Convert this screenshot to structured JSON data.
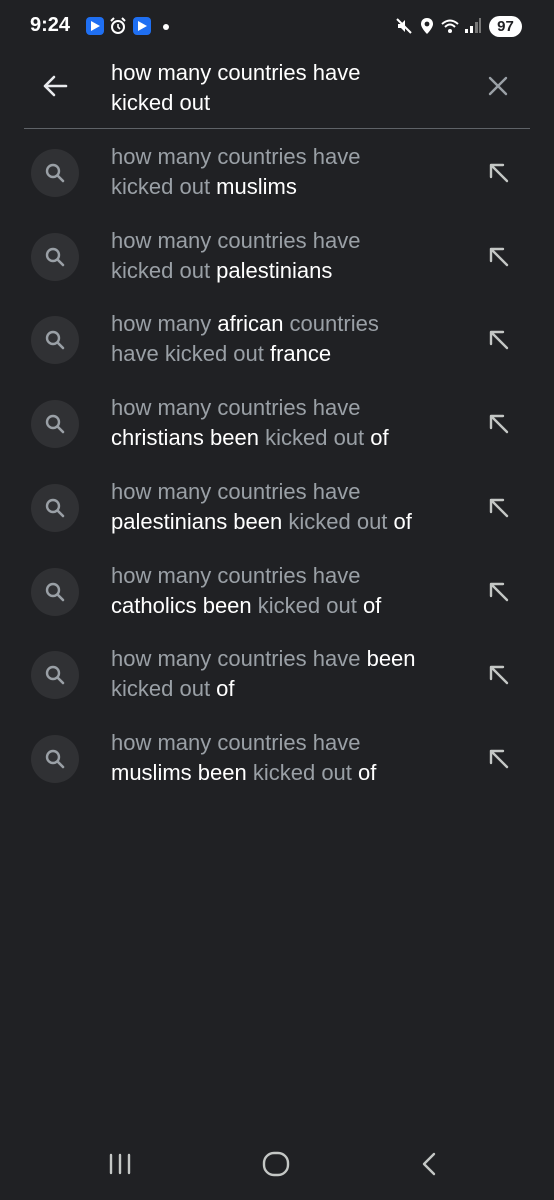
{
  "status_bar": {
    "time": "9:24",
    "battery": "97",
    "icons": [
      "app-icon",
      "alarm-icon",
      "app-icon",
      "dot",
      "mute-icon",
      "location-icon",
      "wifi-icon",
      "signal-icon"
    ]
  },
  "search": {
    "query_line1": "how many countries have",
    "query_line2": "kicked out",
    "back_icon": "arrow-back-icon",
    "clear_icon": "close-icon"
  },
  "suggestions": [
    {
      "line1": [
        {
          "t": "how many countries have",
          "s": "dim"
        }
      ],
      "line2": [
        {
          "t": "kicked out ",
          "s": "dim"
        },
        {
          "t": "muslims",
          "s": "bright"
        }
      ]
    },
    {
      "line1": [
        {
          "t": "how many countries have",
          "s": "dim"
        }
      ],
      "line2": [
        {
          "t": "kicked out ",
          "s": "dim"
        },
        {
          "t": "palestinians",
          "s": "bright"
        }
      ]
    },
    {
      "line1": [
        {
          "t": "how many ",
          "s": "dim"
        },
        {
          "t": "african ",
          "s": "bright"
        },
        {
          "t": "countries",
          "s": "dim"
        }
      ],
      "line2": [
        {
          "t": "have kicked out ",
          "s": "dim"
        },
        {
          "t": "france",
          "s": "bright"
        }
      ]
    },
    {
      "line1": [
        {
          "t": "how many countries have",
          "s": "dim"
        }
      ],
      "line2": [
        {
          "t": "christians been ",
          "s": "bright"
        },
        {
          "t": "kicked out ",
          "s": "dim"
        },
        {
          "t": "of",
          "s": "bright"
        }
      ]
    },
    {
      "line1": [
        {
          "t": "how many countries have",
          "s": "dim"
        }
      ],
      "line2": [
        {
          "t": "palestinians been ",
          "s": "bright"
        },
        {
          "t": "kicked out ",
          "s": "dim"
        },
        {
          "t": "of",
          "s": "bright"
        }
      ]
    },
    {
      "line1": [
        {
          "t": "how many countries have",
          "s": "dim"
        }
      ],
      "line2": [
        {
          "t": "catholics been ",
          "s": "bright"
        },
        {
          "t": "kicked out ",
          "s": "dim"
        },
        {
          "t": "of",
          "s": "bright"
        }
      ]
    },
    {
      "line1": [
        {
          "t": "how many countries have ",
          "s": "dim"
        },
        {
          "t": "been",
          "s": "bright"
        }
      ],
      "line2": [
        {
          "t": "kicked out ",
          "s": "dim"
        },
        {
          "t": "of",
          "s": "bright"
        }
      ]
    },
    {
      "line1": [
        {
          "t": "how many countries have",
          "s": "dim"
        }
      ],
      "line2": [
        {
          "t": "muslims been ",
          "s": "bright"
        },
        {
          "t": "kicked out ",
          "s": "dim"
        },
        {
          "t": "of",
          "s": "bright"
        }
      ]
    }
  ],
  "nav_bar": {
    "recents_icon": "recents-icon",
    "home_icon": "home-icon",
    "back_icon": "back-icon"
  },
  "colors": {
    "background": "#202124",
    "dim_text": "#9aa0a6",
    "bright_text": "#ffffff",
    "circle": "#303134"
  }
}
